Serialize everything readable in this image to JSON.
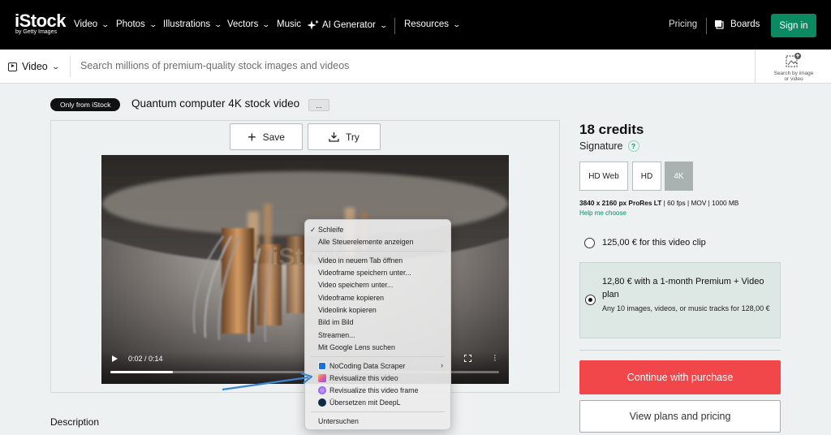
{
  "header": {
    "logo_main": "iStock",
    "logo_sub": "by Getty Images",
    "nav": [
      {
        "label": "Video"
      },
      {
        "label": "Photos"
      },
      {
        "label": "Illustrations"
      },
      {
        "label": "Vectors"
      },
      {
        "label": "Music"
      },
      {
        "label": "AI Generator"
      },
      {
        "label": "Resources"
      }
    ],
    "pricing": "Pricing",
    "boards": "Boards",
    "sign_in": "Sign in"
  },
  "search": {
    "media_type": "Video",
    "placeholder": "Search millions of premium-quality stock images and videos",
    "image_search_line1": "Search by image",
    "image_search_line2": "or video"
  },
  "asset": {
    "badge": "Only from iStock",
    "title": "Quantum computer 4K stock video",
    "more": "..."
  },
  "actions": {
    "save": "Save",
    "try": "Try"
  },
  "player": {
    "time": "0:02 / 0:14",
    "progress_fraction": 0.16
  },
  "context_menu": {
    "loop": "Schleife",
    "show_controls": "Alle Steuerelemente anzeigen",
    "items": [
      "Video in neuem Tab öffnen",
      "Videoframe speichern unter...",
      "Video speichern unter...",
      "Videoframe kopieren",
      "Videolink kopieren",
      "Bild im Bild",
      "Streamen...",
      "Mit Google Lens suchen"
    ],
    "extensions": [
      {
        "label": "NoCoding Data Scraper",
        "icon": "nocoding-scraper-icon"
      },
      {
        "label": "Revisualize this video",
        "icon": "revisualize-icon"
      },
      {
        "label": "Revisualize this video frame",
        "icon": "revisualize-frame-icon"
      },
      {
        "label": "Übersetzen mit DeepL",
        "icon": "deepl-icon"
      }
    ],
    "inspect": "Untersuchen"
  },
  "description_heading": "Description",
  "purchase": {
    "credits": "18 credits",
    "license": "Signature",
    "help": "?",
    "resolutions": [
      "HD Web",
      "HD",
      "4K"
    ],
    "selected_resolution": "4K",
    "spec_resolution": "3840 x 2160 px ProRes LT",
    "spec_rest": "| 60 fps | MOV | 1000 MB",
    "help_choose": "Help me choose",
    "option_single": "125,00 € for this video clip",
    "option_plan_title": "12,80 € with a 1-month Premium + Video plan",
    "option_plan_sub": "Any 10 images, videos, or music tracks for 128,00 €",
    "continue": "Continue with purchase",
    "view_plans": "View plans and pricing"
  },
  "colors": {
    "signin_green": "#0b8a62",
    "continue_red": "#f2474a",
    "plan_bg": "#dde8e5"
  }
}
